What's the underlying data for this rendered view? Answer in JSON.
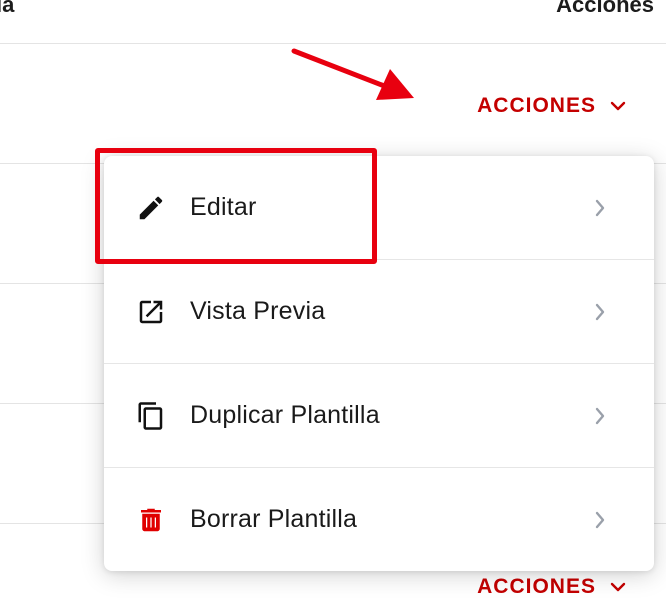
{
  "table": {
    "header_left": "ia",
    "header_right": "Acciones",
    "actions_label": "ACCIONES"
  },
  "menu": {
    "items": [
      {
        "label": "Editar",
        "icon": "pencil-icon"
      },
      {
        "label": "Vista Previa",
        "icon": "open-in-new-icon"
      },
      {
        "label": "Duplicar Plantilla",
        "icon": "copy-icon"
      },
      {
        "label": "Borrar Plantilla",
        "icon": "trash-icon"
      }
    ]
  },
  "colors": {
    "accent": "#c40000",
    "annotation": "#e8000f",
    "delete_icon": "#e00000",
    "chevron": "#9aa0aa"
  }
}
